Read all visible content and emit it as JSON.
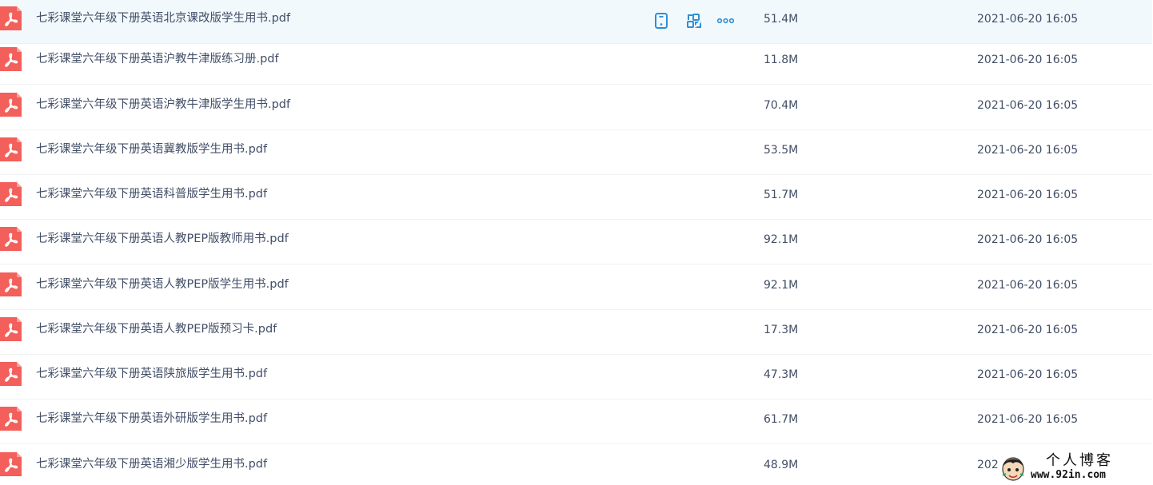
{
  "files": [
    {
      "name": "七彩课堂六年级下册英语北京课改版学生用书.pdf",
      "size": "51.4M",
      "date": "2021-06-20 16:05",
      "type_icon": "pdf-icon"
    },
    {
      "name": "七彩课堂六年级下册英语沪教牛津版练习册.pdf",
      "size": "11.8M",
      "date": "2021-06-20 16:05",
      "type_icon": "pdf-icon"
    },
    {
      "name": "七彩课堂六年级下册英语沪教牛津版学生用书.pdf",
      "size": "70.4M",
      "date": "2021-06-20 16:05",
      "type_icon": "pdf-icon"
    },
    {
      "name": "七彩课堂六年级下册英语冀教版学生用书.pdf",
      "size": "53.5M",
      "date": "2021-06-20 16:05",
      "type_icon": "pdf-icon"
    },
    {
      "name": "七彩课堂六年级下册英语科普版学生用书.pdf",
      "size": "51.7M",
      "date": "2021-06-20 16:05",
      "type_icon": "pdf-icon"
    },
    {
      "name": "七彩课堂六年级下册英语人教PEP版教师用书.pdf",
      "size": "92.1M",
      "date": "2021-06-20 16:05",
      "type_icon": "pdf-icon"
    },
    {
      "name": "七彩课堂六年级下册英语人教PEP版学生用书.pdf",
      "size": "92.1M",
      "date": "2021-06-20 16:05",
      "type_icon": "pdf-icon"
    },
    {
      "name": "七彩课堂六年级下册英语人教PEP版预习卡.pdf",
      "size": "17.3M",
      "date": "2021-06-20 16:05",
      "type_icon": "pdf-icon"
    },
    {
      "name": "七彩课堂六年级下册英语陕旅版学生用书.pdf",
      "size": "47.3M",
      "date": "2021-06-20 16:05",
      "type_icon": "pdf-icon"
    },
    {
      "name": "七彩课堂六年级下册英语外研版学生用书.pdf",
      "size": "61.7M",
      "date": "2021-06-20 16:05",
      "type_icon": "pdf-icon"
    },
    {
      "name": "七彩课堂六年级下册英语湘少版学生用书.pdf",
      "size": "48.9M",
      "date": "2021-06-20 16:05",
      "type_icon": "pdf-icon"
    }
  ],
  "row_actions": [
    "phone-icon",
    "share-icon",
    "more-icon"
  ],
  "watermark": {
    "title": "个人博客",
    "url": "www.92in.com",
    "avatar_icon": "avatar-icon"
  },
  "colors": {
    "pdf_red": "#f35f5a",
    "action_blue": "#2e8fd6",
    "text": "#424e67",
    "hover_bg": "#f2f9fd",
    "divider": "#f1f2f4"
  }
}
